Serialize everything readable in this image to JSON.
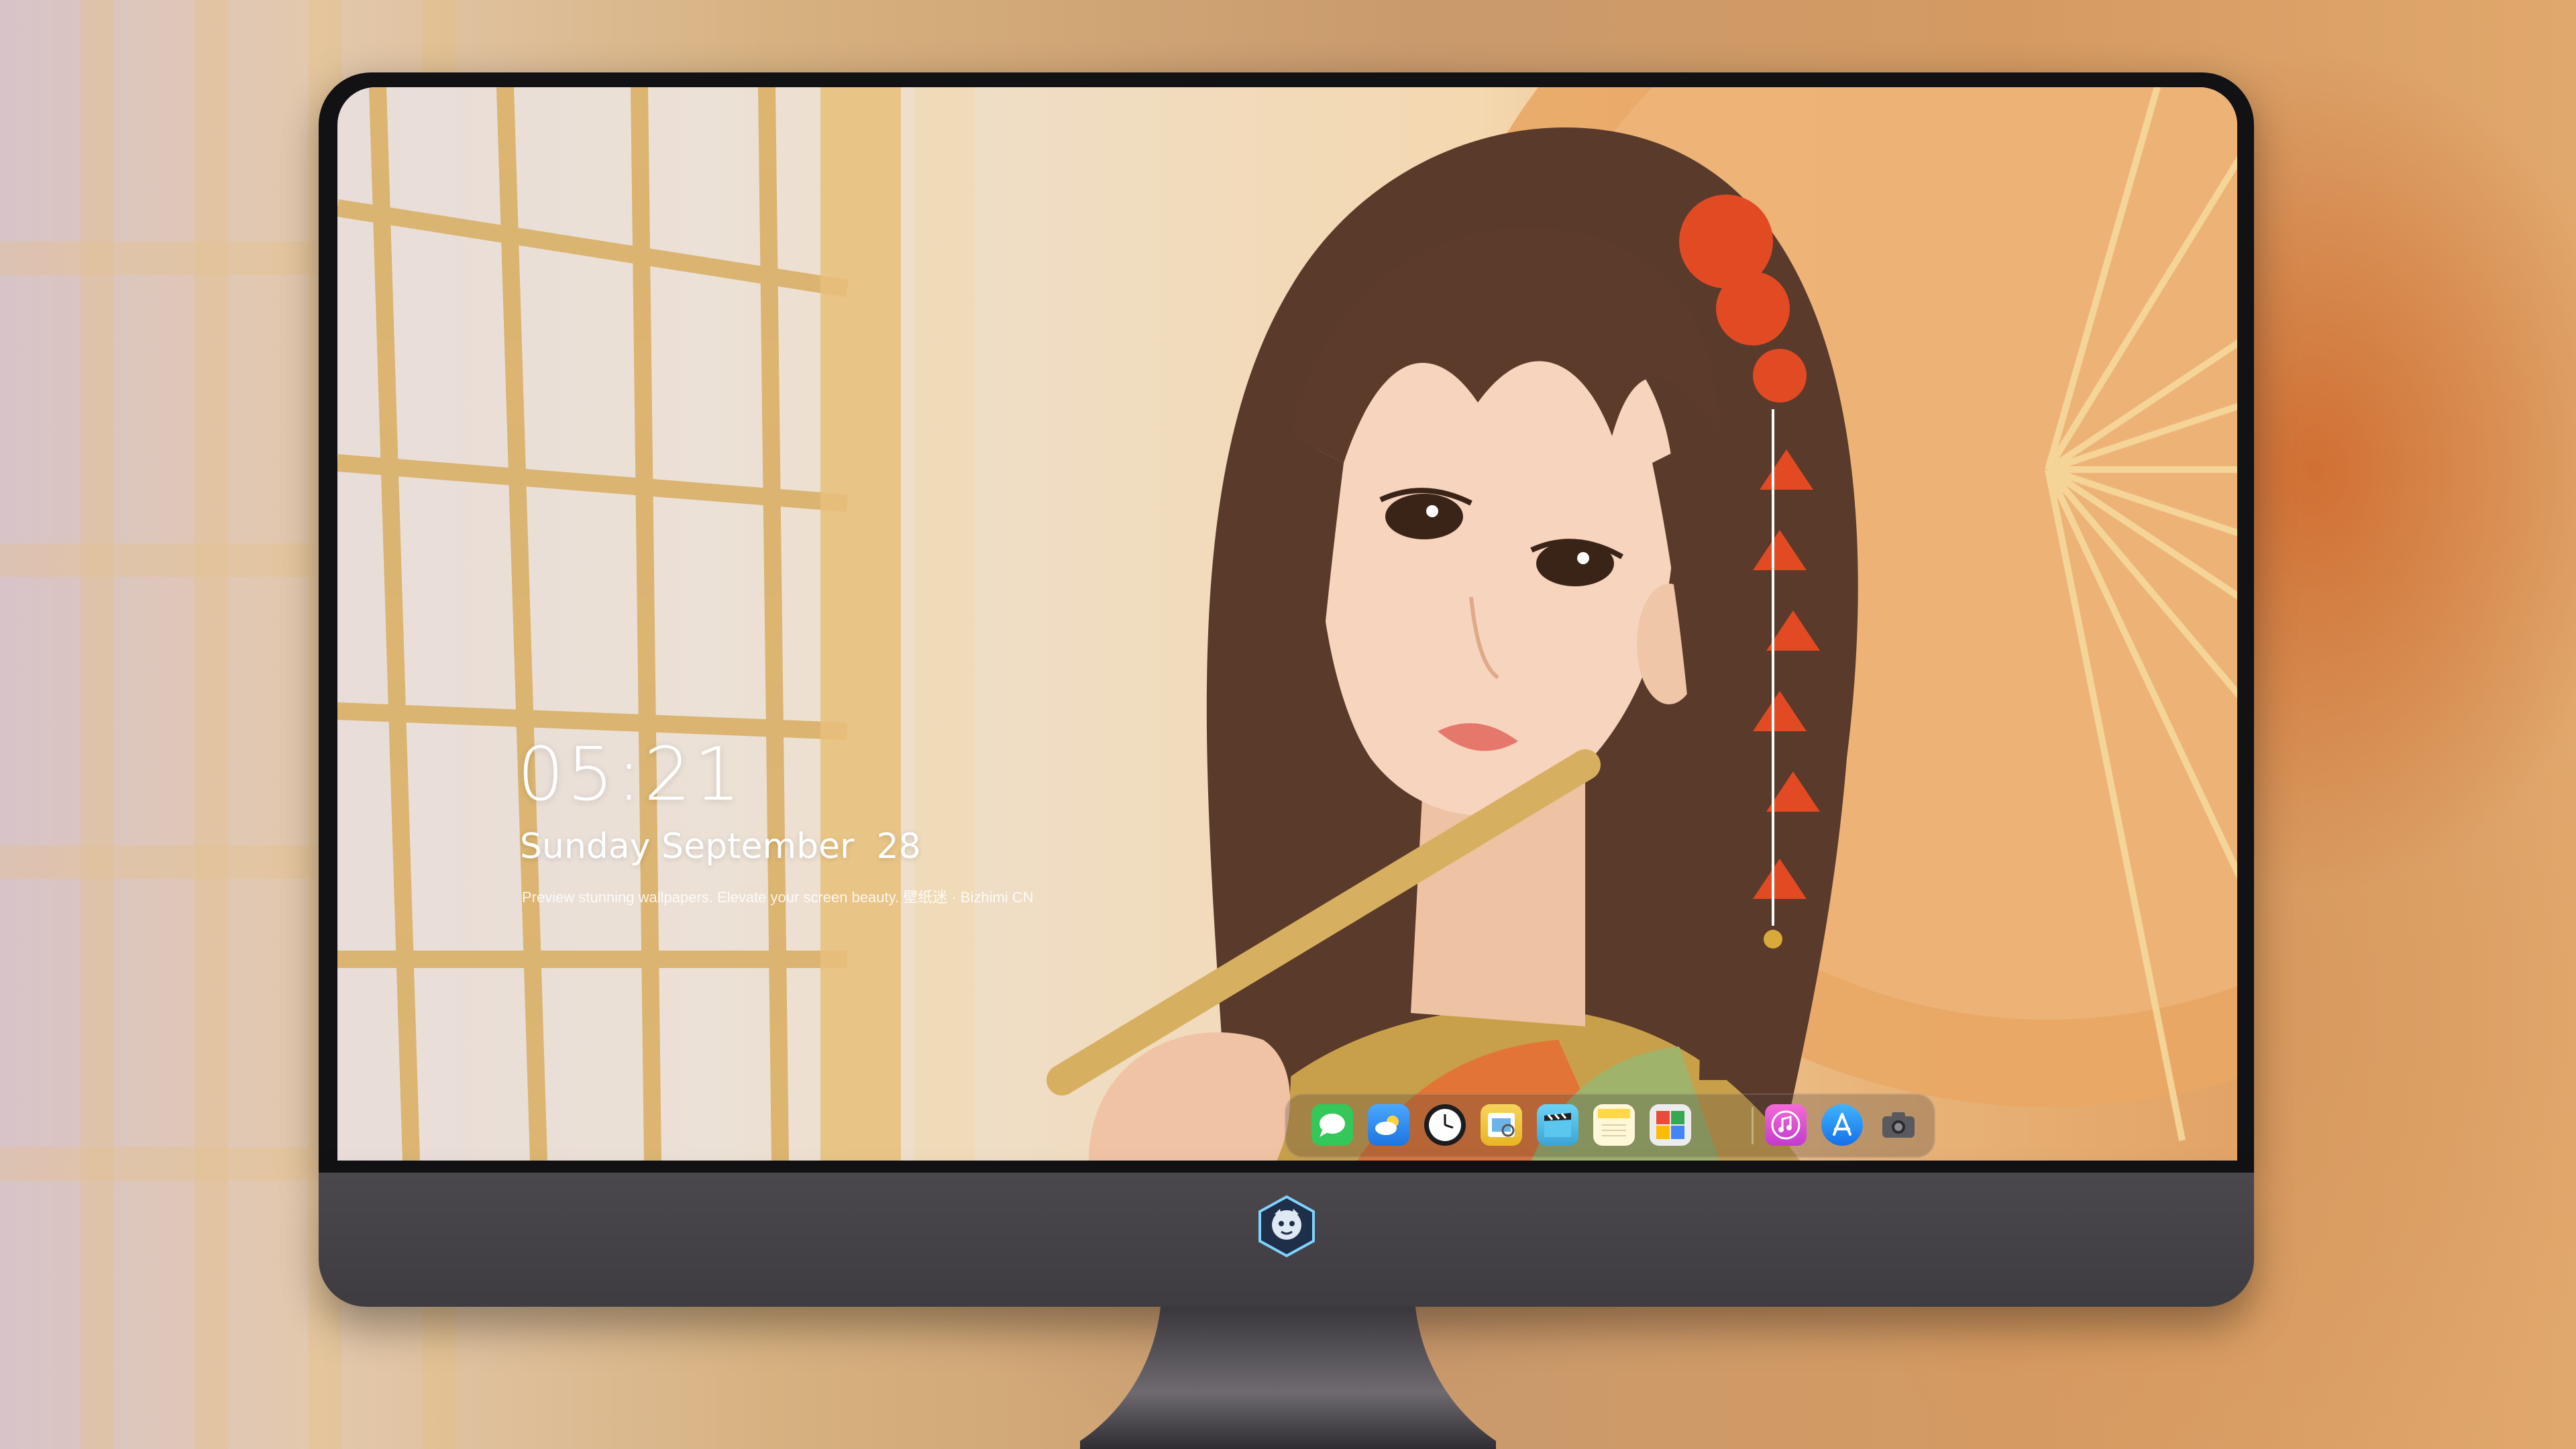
{
  "lockscreen": {
    "time": "05:21",
    "date": "Sunday September  28",
    "tagline": "Preview stunning wallpapers. Elevate your screen beauty. 壁纸迷 · Bizhimi CN"
  },
  "dock": {
    "apps": [
      {
        "name": "messages-icon",
        "color": "#34c759"
      },
      {
        "name": "weather-icon",
        "color": "#2f8cf0"
      },
      {
        "name": "clock-icon",
        "color": "#1c1c1e"
      },
      {
        "name": "preview-icon",
        "color": "#f2c230"
      },
      {
        "name": "clips-icon",
        "color": "#4fb8e6"
      },
      {
        "name": "notes-icon",
        "color": "#ffd84a"
      },
      {
        "name": "photo-booth-icon",
        "color": "#e94b3c"
      },
      {
        "name": "itunes-icon",
        "color": "#e54cc6"
      },
      {
        "name": "app-store-icon",
        "color": "#1f8ef1"
      },
      {
        "name": "screenshot-icon",
        "color": "#4a4a4a"
      }
    ]
  },
  "monitor": {
    "logo": "dragon-mascot-logo"
  }
}
